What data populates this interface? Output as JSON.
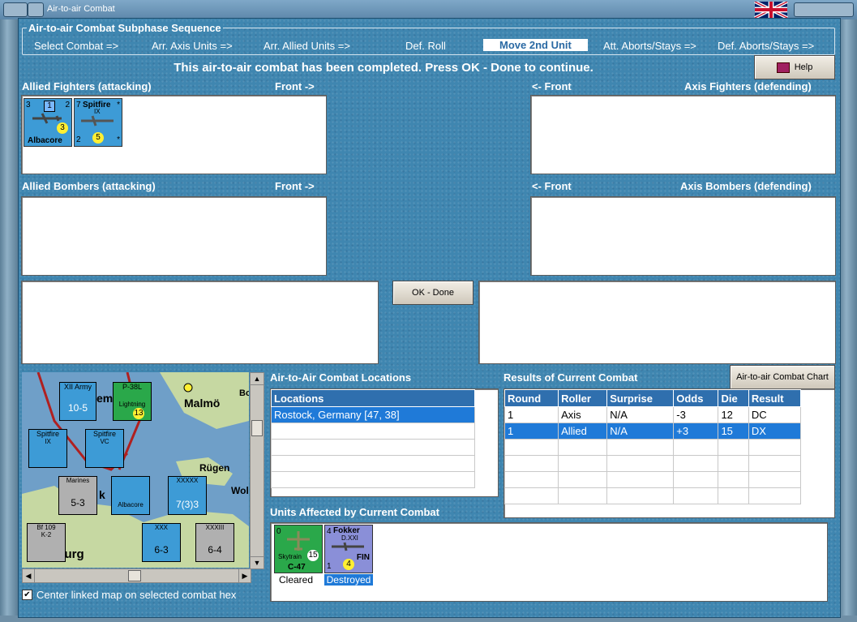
{
  "window": {
    "title": "Air-to-air Combat"
  },
  "sequence": {
    "title": "Air-to-air Combat Subphase Sequence",
    "items": [
      {
        "label": "Select Combat =>"
      },
      {
        "label": "Arr. Axis Units =>"
      },
      {
        "label": "Arr. Allied Units =>"
      },
      {
        "label": "Def. Roll"
      },
      {
        "label": "Move 2nd Unit",
        "active": true
      },
      {
        "label": "Att. Aborts/Stays =>"
      },
      {
        "label": "Def. Aborts/Stays =>"
      }
    ]
  },
  "status_message": "This air-to-air combat has been completed.  Press OK - Done to continue.",
  "help_label": "Help",
  "sections": {
    "allied_fighters": "Allied Fighters (attacking)",
    "allied_fighters_front": "Front ->",
    "axis_fighters": "Axis Fighters (defending)",
    "axis_fighters_front": "<- Front",
    "allied_bombers": "Allied Bombers (attacking)",
    "allied_bombers_front": "Front ->",
    "axis_bombers": "Axis Bombers (defending)",
    "axis_bombers_front": "<- Front"
  },
  "allied_fighter_units": [
    {
      "name": "Albacore",
      "tl": "3",
      "tr": "2",
      "bl": "",
      "br": "*",
      "badge": "1",
      "circle": "3",
      "color": "#3d9bd6"
    },
    {
      "name": "Spitfire",
      "sub": "IX",
      "tl": "7",
      "tr": "*",
      "bl": "2",
      "br": "*",
      "circle": "5",
      "color": "#3d9bd6"
    }
  ],
  "ok_done_label": "OK - Done",
  "locations": {
    "heading": "Air-to-Air Combat Locations",
    "column": "Locations",
    "rows": [
      "Rostock, Germany [47, 38]"
    ]
  },
  "results": {
    "heading": "Results of Current Combat",
    "chart_button": "Air-to-air Combat Chart",
    "columns": [
      "Round",
      "Roller",
      "Surprise",
      "Odds",
      "Die",
      "Result"
    ],
    "rows": [
      [
        "1",
        "Axis",
        "N/A",
        "-3",
        "12",
        "DC"
      ],
      [
        "1",
        "Allied",
        "N/A",
        "+3",
        "15",
        "DX"
      ]
    ]
  },
  "affected": {
    "heading": "Units Affected by Current Combat",
    "units": [
      {
        "name": "C-47",
        "top": "0",
        "circle": "15",
        "sub": "Skytrain",
        "status": "Cleared",
        "color": "#2aa84a"
      },
      {
        "name": "Fokker",
        "sub": "D.XXI",
        "top": "4",
        "bottom": "1",
        "tag": "FIN",
        "circle": "4",
        "status": "Destroyed",
        "color": "#8a8fd8"
      }
    ]
  },
  "map": {
    "labels": [
      "Malmö",
      "Rügen",
      "Wol",
      "Bo",
      "mburg",
      "em",
      "k"
    ],
    "center_label": "Center linked map on selected combat hex",
    "center_checked": true,
    "counters": [
      {
        "name": "XII Army",
        "value": "10-5"
      },
      {
        "name": "P-38L",
        "sub": "Lightning",
        "value": "13"
      },
      {
        "name": "Spitfire",
        "sub": "IX"
      },
      {
        "name": "Spitfire",
        "sub": "VC"
      },
      {
        "name": "Albacore"
      },
      {
        "name": "Marines",
        "value": "5-3"
      },
      {
        "name": "XXXXX",
        "value": "7(3)3"
      },
      {
        "name": "Bf 109",
        "sub": "K-2"
      },
      {
        "name": "XXX",
        "value": "6-3"
      },
      {
        "name": "XXXIII",
        "value": "6-4"
      }
    ]
  },
  "colors": {
    "accent": "#2f6fae",
    "background": "#3f86b0",
    "selection": "#1f7ad8"
  }
}
